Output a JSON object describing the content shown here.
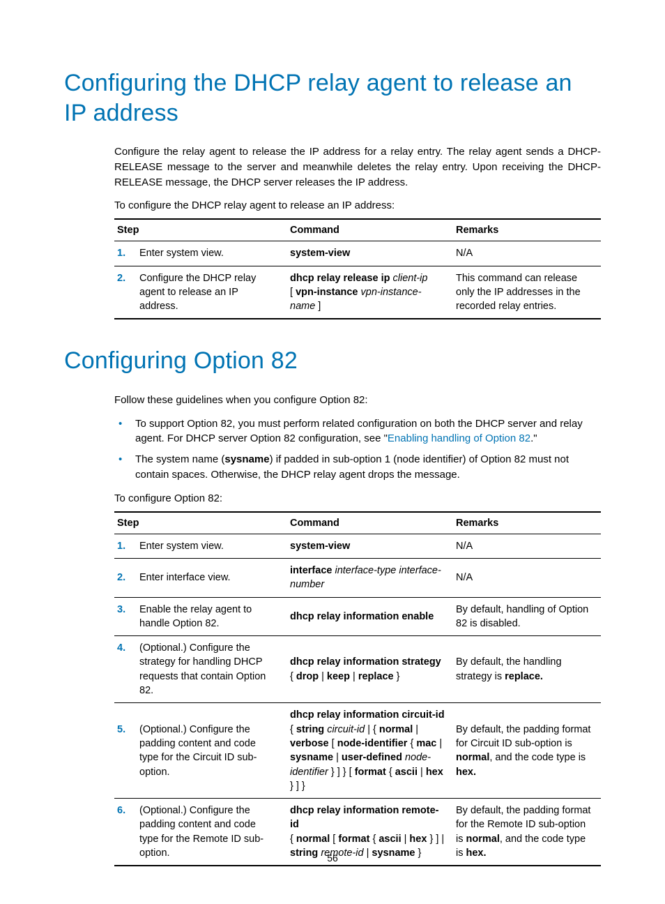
{
  "pageNumber": "56",
  "section1": {
    "heading": "Configuring the DHCP relay agent to release an IP address",
    "para1": "Configure the relay agent to release the IP address for a relay entry. The relay agent sends a DHCP-RELEASE message to the server and meanwhile deletes the relay entry. Upon receiving the DHCP-RELEASE message, the DHCP server releases the IP address.",
    "caption": "To configure the DHCP relay agent to release an IP address:",
    "table": {
      "headers": {
        "step": "Step",
        "command": "Command",
        "remarks": "Remarks"
      },
      "rows": [
        {
          "num": "1.",
          "step": "Enter system view.",
          "cmd_html": "<span class='bold'>system-view</span>",
          "remarks": "N/A"
        },
        {
          "num": "2.",
          "step": "Configure the DHCP relay agent to release an IP address.",
          "cmd_html": "<span class='bold'>dhcp relay release ip</span> <span class='ital'>client-ip</span><br>[ <span class='bold'>vpn-instance</span> <span class='ital'>vpn-instance-name</span> ]",
          "remarks": "This command can release only the IP addresses in the recorded relay entries."
        }
      ]
    }
  },
  "section2": {
    "heading": "Configuring Option 82",
    "para1": "Follow these guidelines when you configure Option 82:",
    "bullets": {
      "b1_html": "To support Option 82, you must perform related configuration on both the DHCP server and relay agent. For DHCP server Option 82 configuration, see \"<span class='link'>Enabling handling of Option 82</span>.\"",
      "b2_html": "The system name (<span class='bold'>sysname</span>) if padded in sub-option 1 (node identifier) of Option 82 must not contain spaces. Otherwise, the DHCP relay agent drops the message."
    },
    "caption": "To configure Option 82:",
    "table": {
      "headers": {
        "step": "Step",
        "command": "Command",
        "remarks": "Remarks"
      },
      "rows": [
        {
          "num": "1.",
          "step": "Enter system view.",
          "cmd_html": "<span class='bold'>system-view</span>",
          "remarks_html": "N/A"
        },
        {
          "num": "2.",
          "step": "Enter interface view.",
          "cmd_html": "<span class='bold'>interface</span> <span class='ital'>interface-type interface-number</span>",
          "remarks_html": "N/A"
        },
        {
          "num": "3.",
          "step": "Enable the relay agent to handle Option 82.",
          "cmd_html": "<span class='bold'>dhcp relay information enable</span>",
          "remarks_html": "By default, handling of Option 82 is disabled."
        },
        {
          "num": "4.",
          "step": "(Optional.) Configure the strategy for handling DHCP requests that contain Option 82.",
          "cmd_html": "<span class='bold'>dhcp relay information strategy</span><br>{ <span class='bold'>drop</span> | <span class='bold'>keep</span> | <span class='bold'>replace</span> }",
          "remarks_html": "By default, the handling strategy is <span class='bold'>replace.</span>"
        },
        {
          "num": "5.",
          "step": "(Optional.) Configure the padding content and code type for the Circuit ID sub-option.",
          "cmd_html": "<span class='bold'>dhcp relay information circuit-id</span><br>{ <span class='bold'>string</span> <span class='ital'>circuit-id</span> | { <span class='bold'>normal</span> | <span class='bold'>verbose</span> [ <span class='bold'>node-identifier</span> { <span class='bold'>mac</span> | <span class='bold'>sysname</span> | <span class='bold'>user-defined</span> <span class='ital'>node-identifier</span> } ] } [ <span class='bold'>format</span> { <span class='bold'>ascii</span> | <span class='bold'>hex</span> } ] }",
          "remarks_html": "By default, the padding format for Circuit ID sub-option is <span class='bold'>normal</span>, and the code type is <span class='bold'>hex.</span>"
        },
        {
          "num": "6.",
          "step": "(Optional.) Configure the padding content and code type for the Remote ID sub-option.",
          "cmd_html": "<span class='bold'>dhcp relay information remote-id</span><br>{ <span class='bold'>normal</span> [ <span class='bold'>format</span> { <span class='bold'>ascii</span> | <span class='bold'>hex</span> } ] | <span class='bold'>string</span> <span class='ital'>remote-id</span> | <span class='bold'>sysname</span> }",
          "remarks_html": "By default, the padding format for the Remote ID sub-option is <span class='bold'>normal</span>, and the code type is <span class='bold'>hex.</span>"
        }
      ]
    }
  }
}
